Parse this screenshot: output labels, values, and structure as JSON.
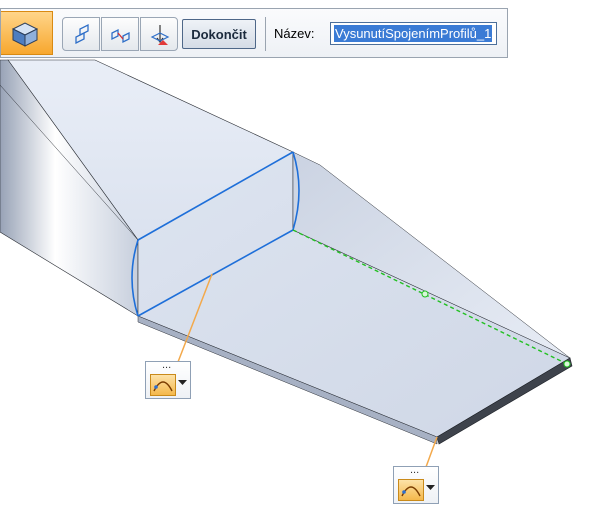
{
  "toolbar": {
    "main_icon": "extrude-solid-icon",
    "step_icons": [
      "cross-section-step-icon",
      "path-step-icon",
      "extent-step-icon"
    ],
    "finish_label": "Dokončit",
    "name_label": "Název:",
    "name_value": "VysunutíSpojenímProfilů_1"
  },
  "quicksteps": [
    {
      "dots": "...",
      "icon": "vertex-mapping-icon",
      "menu_icon": "dropdown-arrow-icon"
    },
    {
      "dots": "...",
      "icon": "vertex-mapping-icon",
      "menu_icon": "dropdown-arrow-icon"
    }
  ],
  "colors": {
    "model_face": "#dfe5f1",
    "profile_selected": "#1e6fd9",
    "connection_line": "#22c022",
    "leader_line": "#f3a94b",
    "toolbar_accent": "#f7a72e"
  }
}
